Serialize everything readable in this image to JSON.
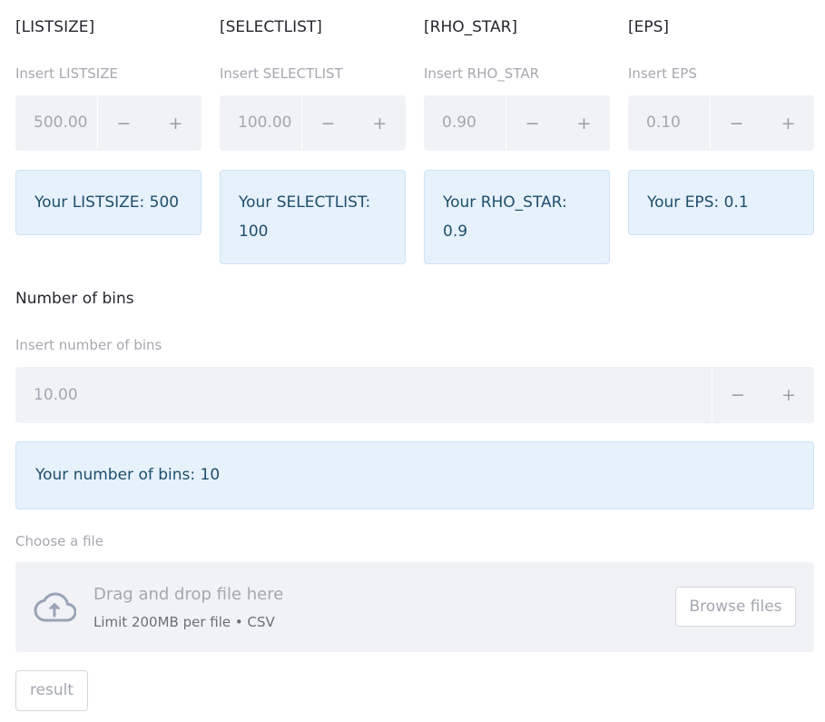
{
  "params": [
    {
      "heading": "[LISTSIZE]",
      "label": "Insert LISTSIZE",
      "value": "500.00",
      "info": "Your LISTSIZE: 500"
    },
    {
      "heading": "[SELECTLIST]",
      "label": "Insert SELECTLIST",
      "value": "100.00",
      "info": "Your SELECTLIST: 100"
    },
    {
      "heading": "[RHO_STAR]",
      "label": "Insert RHO_STAR",
      "value": "0.90",
      "info": "Your RHO_STAR: 0.9"
    },
    {
      "heading": "[EPS]",
      "label": "Insert EPS",
      "value": "0.10",
      "info": "Your EPS: 0.1"
    }
  ],
  "stepper": {
    "minus": "−",
    "plus": "+"
  },
  "bins": {
    "heading": "Number of bins",
    "label": "Insert number of bins",
    "value": "10.00",
    "info": "Your number of bins: 10"
  },
  "uploader": {
    "label": "Choose a file",
    "title": "Drag and drop file here",
    "subtitle": "Limit 200MB per file • CSV",
    "browse_label": "Browse files",
    "icon": "cloud-upload-icon"
  },
  "result_button": "result",
  "colors": {
    "input_bg": "#f0f2f6",
    "info_bg": "#e6f1fc",
    "info_text": "#1e4e6b",
    "muted_text": "#a4a7b0"
  }
}
